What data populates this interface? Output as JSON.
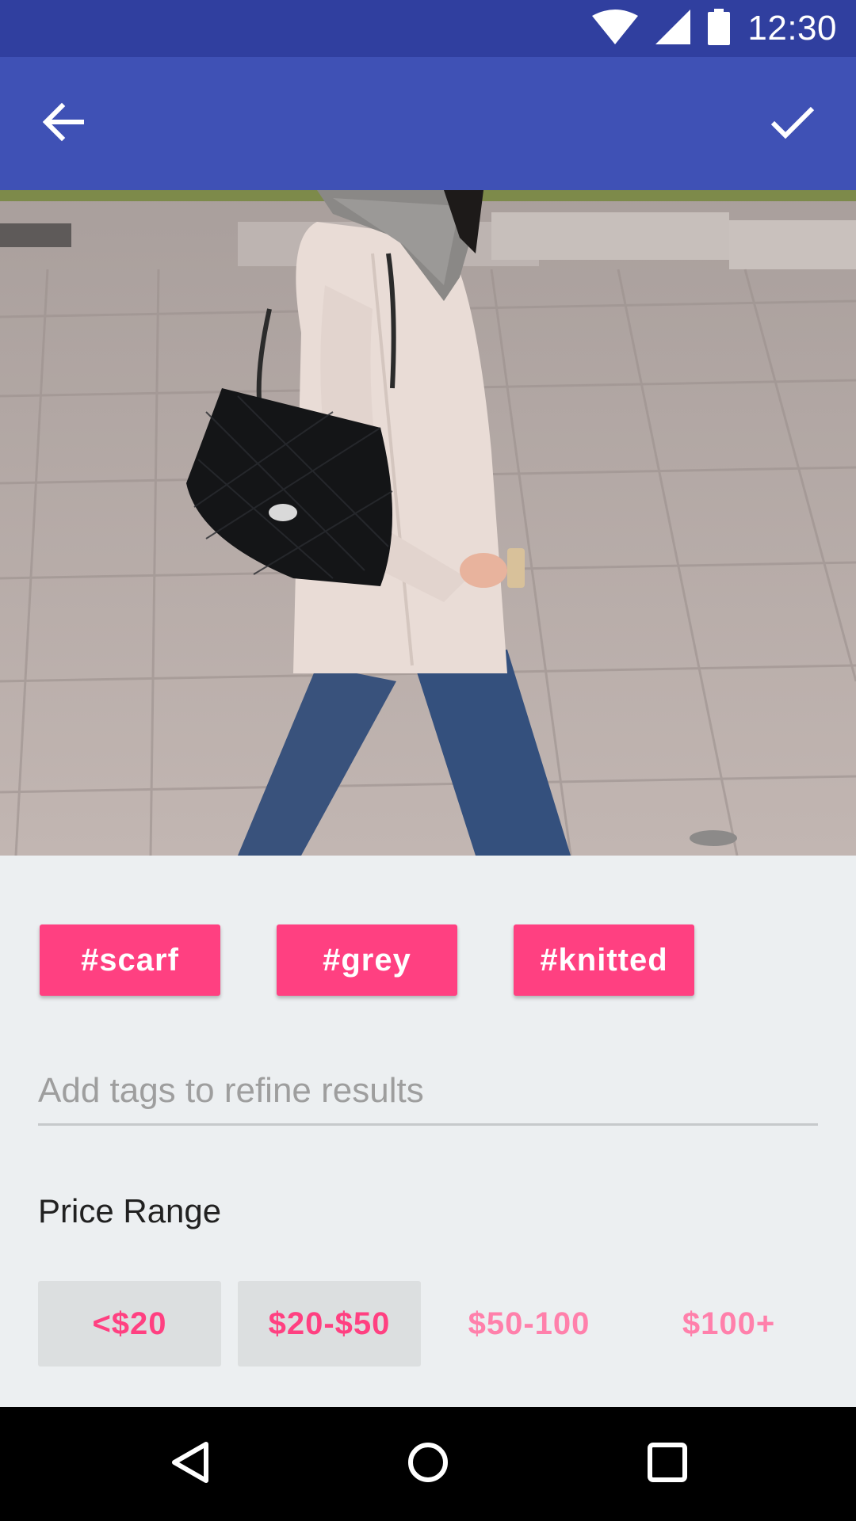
{
  "status_bar": {
    "time": "12:30",
    "icons": [
      "wifi-icon",
      "cell-signal-icon",
      "battery-icon"
    ]
  },
  "app_bar": {
    "back_icon": "arrow-back-icon",
    "confirm_icon": "check-icon",
    "color": "#3f51b5"
  },
  "photo": {
    "subject": "photo"
  },
  "tags": [
    {
      "label": "#scarf"
    },
    {
      "label": "#grey"
    },
    {
      "label": "#knitted"
    }
  ],
  "tag_input": {
    "value": "",
    "placeholder": "Add tags to refine results"
  },
  "price": {
    "title": "Price Range",
    "options": [
      {
        "label": "<$20",
        "selected": true
      },
      {
        "label": "$20-$50",
        "selected": true
      },
      {
        "label": "$50-100",
        "selected": false
      },
      {
        "label": "$100+",
        "selected": false
      }
    ]
  },
  "nav_bar": {
    "icons": [
      "back-triangle-icon",
      "home-circle-icon",
      "recents-square-icon"
    ]
  },
  "colors": {
    "accent": "#ff4081",
    "accent_light": "#ff80ab",
    "primary": "#3f51b5",
    "primary_dark": "#303f9f",
    "background": "#eceff1"
  }
}
